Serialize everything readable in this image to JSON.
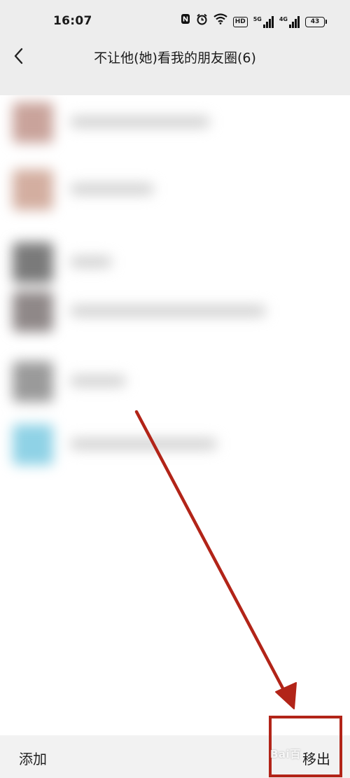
{
  "status_bar": {
    "time": "16:07",
    "icons": [
      "nfc-icon",
      "alarm-icon",
      "wifi-icon",
      "hd-icon",
      "5g-signal-icon",
      "4g-signal-icon",
      "battery-icon"
    ],
    "hd_label": "HD",
    "net_5g": "5G",
    "net_4g": "4G",
    "battery": "43"
  },
  "nav": {
    "back_icon": "chevron-left-icon",
    "title": "不让他(她)看我的朋友圈(6)"
  },
  "list": {
    "item_count": 6,
    "avatar_colors": [
      "#c9a39b",
      "#d3aea0",
      "#7a7a7a",
      "#8f8888",
      "#9a9a9a",
      "#8fd2e6"
    ]
  },
  "bottom_bar": {
    "add_label": "添加",
    "remove_label": "移出"
  },
  "annotation": {
    "arrow_color": "#b22418",
    "box_color": "#b22418"
  },
  "watermark": {
    "text": "Bai百"
  }
}
